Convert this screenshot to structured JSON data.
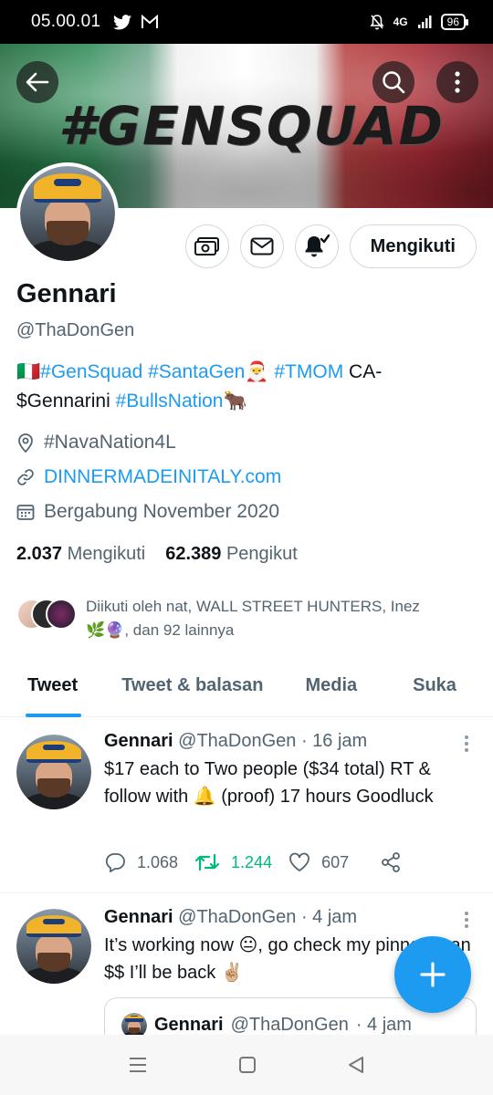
{
  "status_bar": {
    "time": "05.00.01",
    "network": "4G",
    "battery": "96",
    "notification_icons": [
      "twitter-icon",
      "gmail-icon"
    ],
    "system_icons": [
      "mute-icon",
      "signal-icon",
      "battery-icon"
    ]
  },
  "header": {
    "banner_text": "#GENSQUAD",
    "back_icon": "arrow-left-icon",
    "search_icon": "search-icon",
    "more_icon": "more-vertical-icon"
  },
  "profile": {
    "name": "Gennari",
    "handle": "@ThaDonGen",
    "follow_button": "Mengikuti",
    "bio": {
      "flag": "🇮🇹",
      "tag1": "#GenSquad",
      "tag2": "#SantaGen",
      "emoji1": "🎅",
      "tag3": "#TMOM",
      "text1": "CA-",
      "cashtag": "$Gennarini",
      "tag4": "#BullsNation",
      "emoji2": "🐂"
    },
    "location": "#NavaNation4L",
    "website": "DINNERMADEINITALY.com",
    "joined": "Bergabung November 2020",
    "following_count": "2.037",
    "following_label": "Mengikuti",
    "followers_count": "62.389",
    "followers_label": "Pengikut",
    "followed_by_line1": "Diikuti oleh nat, WALL STREET HUNTERS, Inez",
    "followed_by_emoji": "🌿🔮",
    "followed_by_line2": ", dan 92 lainnya"
  },
  "tabs": [
    "Tweet",
    "Tweet & balasan",
    "Media",
    "Suka"
  ],
  "tweets": [
    {
      "name": "Gennari",
      "handle": "@ThaDonGen",
      "time": "· 16 jam",
      "text_part1": "$17 each to Two people ($34 total) RT & follow with ",
      "emoji": "🔔",
      "text_part2": " (proof) 17 hours Goodluck",
      "replies": "1.068",
      "retweets": "1.244",
      "likes": "607"
    },
    {
      "name": "Gennari",
      "handle": "@ThaDonGen",
      "time": "· 4 jam",
      "text_part1": "It’s working now ",
      "emoji": "😐",
      "text_part2": ", go check my pinned man $$ I’ll be back ",
      "emoji2": "✌🏼",
      "quote": {
        "name": "Gennari",
        "handle": "@ThaDonGen",
        "time": "· 4 jam"
      }
    }
  ],
  "colors": {
    "accent": "#1d9bf0",
    "retweet": "#00ba7c",
    "secondary_text": "#536471",
    "primary_text": "#0f1419"
  }
}
